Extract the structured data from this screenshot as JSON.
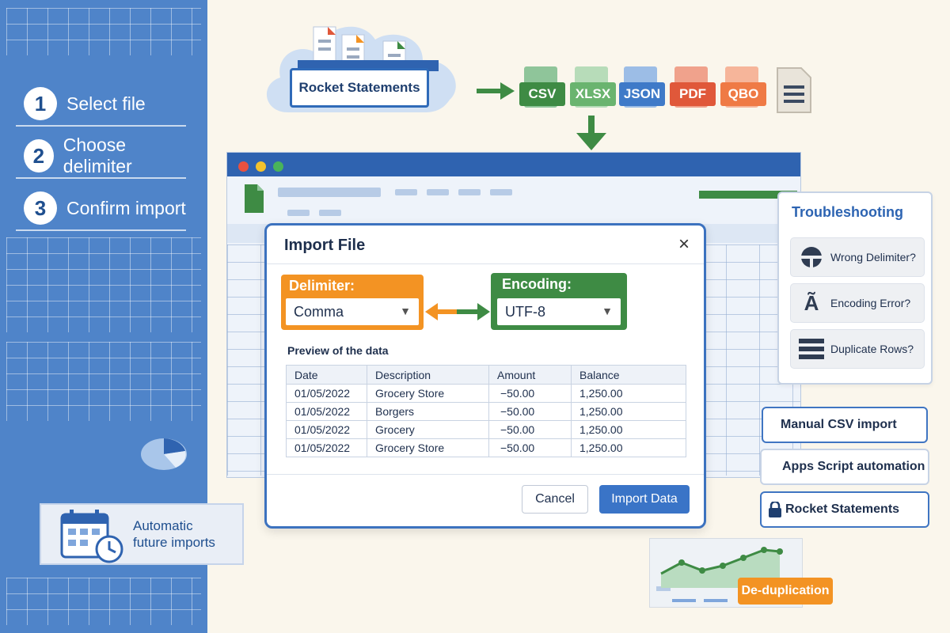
{
  "steps": [
    {
      "num": "1",
      "label": "Select file"
    },
    {
      "num": "2",
      "label": "Choose delimiter"
    },
    {
      "num": "3",
      "label": "Confirm import"
    }
  ],
  "automatic": {
    "label_line1": "Automatic",
    "label_line2": "future imports"
  },
  "source": {
    "label": "Rocket Statements"
  },
  "formats": [
    {
      "label": "CSV",
      "color": "#3e8b44",
      "body": "#8fc59a"
    },
    {
      "label": "XLSX",
      "color": "#6ab46f",
      "body": "#b7dcb9"
    },
    {
      "label": "JSON",
      "color": "#3f7ac8",
      "body": "#9cbde6"
    },
    {
      "label": "PDF",
      "color": "#e0583a",
      "body": "#f0a28c"
    },
    {
      "label": "QBO",
      "color": "#ef7a45",
      "body": "#f6b59a"
    }
  ],
  "dialog": {
    "title": "Import File",
    "delimiter_label": "Delimiter:",
    "delimiter_value": "Comma",
    "encoding_label": "Encoding:",
    "encoding_value": "UTF-8",
    "preview_label": "Preview of the data",
    "columns": [
      "Date",
      "Description",
      "Amount",
      "Balance"
    ],
    "rows": [
      [
        "01/05/2022",
        "Grocery Store",
        "−50.00",
        "1,250.00"
      ],
      [
        "01/05/2022",
        "Borgers",
        "−50.00",
        "1,250.00"
      ],
      [
        "01/05/2022",
        "Grocery",
        "−50.00",
        "1,250.00"
      ],
      [
        "01/05/2022",
        "Grocery Store",
        "−50.00",
        "1,250.00"
      ]
    ],
    "cancel_label": "Cancel",
    "import_label": "Import Data"
  },
  "troubleshooting": {
    "title": "Troubleshooting",
    "items": [
      "Wrong Delimiter?",
      "Encoding Error?",
      "Duplicate Rows?"
    ]
  },
  "options": [
    "Manual CSV import",
    "Apps Script automation",
    "Rocket Statements"
  ],
  "dedup_label": "De-duplication",
  "colors": {
    "accent_blue": "#3a74c7",
    "orange": "#f39323",
    "green": "#3e8b44",
    "panel_blue": "#4f84c9"
  }
}
